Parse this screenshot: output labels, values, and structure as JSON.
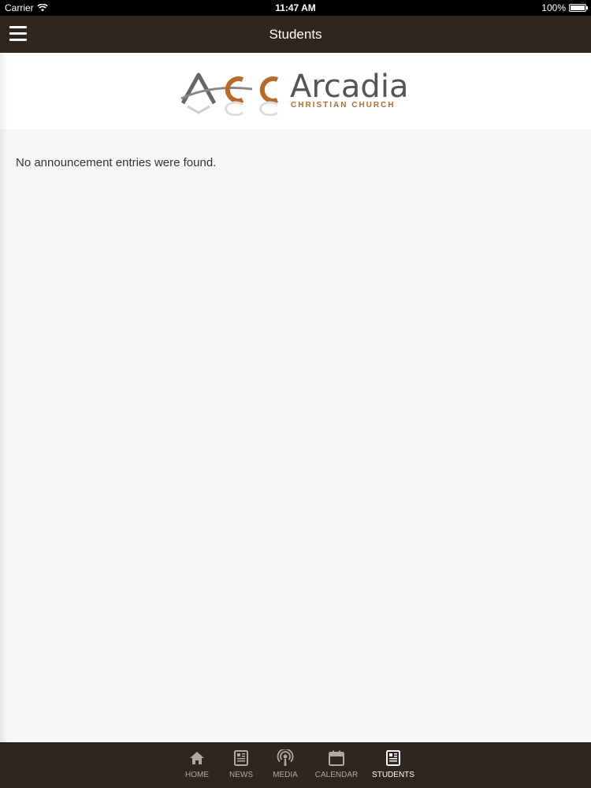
{
  "status_bar": {
    "carrier": "Carrier",
    "time": "11:47 AM",
    "battery": "100%",
    "battery_level": 1.0
  },
  "nav": {
    "title": "Students",
    "menu_icon": "hamburger-menu-icon"
  },
  "logo": {
    "mark": "ACC",
    "name": "Arcadia",
    "subtitle": "CHRISTIAN CHURCH",
    "colors": {
      "gray": "#555555",
      "orange": "#b86a2a"
    }
  },
  "content": {
    "empty_message": "No announcement entries were found."
  },
  "tabs": [
    {
      "label": "HOME",
      "icon": "home-icon",
      "active": false
    },
    {
      "label": "NEWS",
      "icon": "news-icon",
      "active": false
    },
    {
      "label": "MEDIA",
      "icon": "podcast-icon",
      "active": false
    },
    {
      "label": "CALENDAR",
      "icon": "calendar-icon",
      "active": false
    },
    {
      "label": "STUDENTS",
      "icon": "students-news-icon",
      "active": true
    }
  ],
  "colors": {
    "nav_bg": "#2f2620",
    "tab_active": "#ffffff",
    "tab_inactive": "#aaaaaa"
  }
}
